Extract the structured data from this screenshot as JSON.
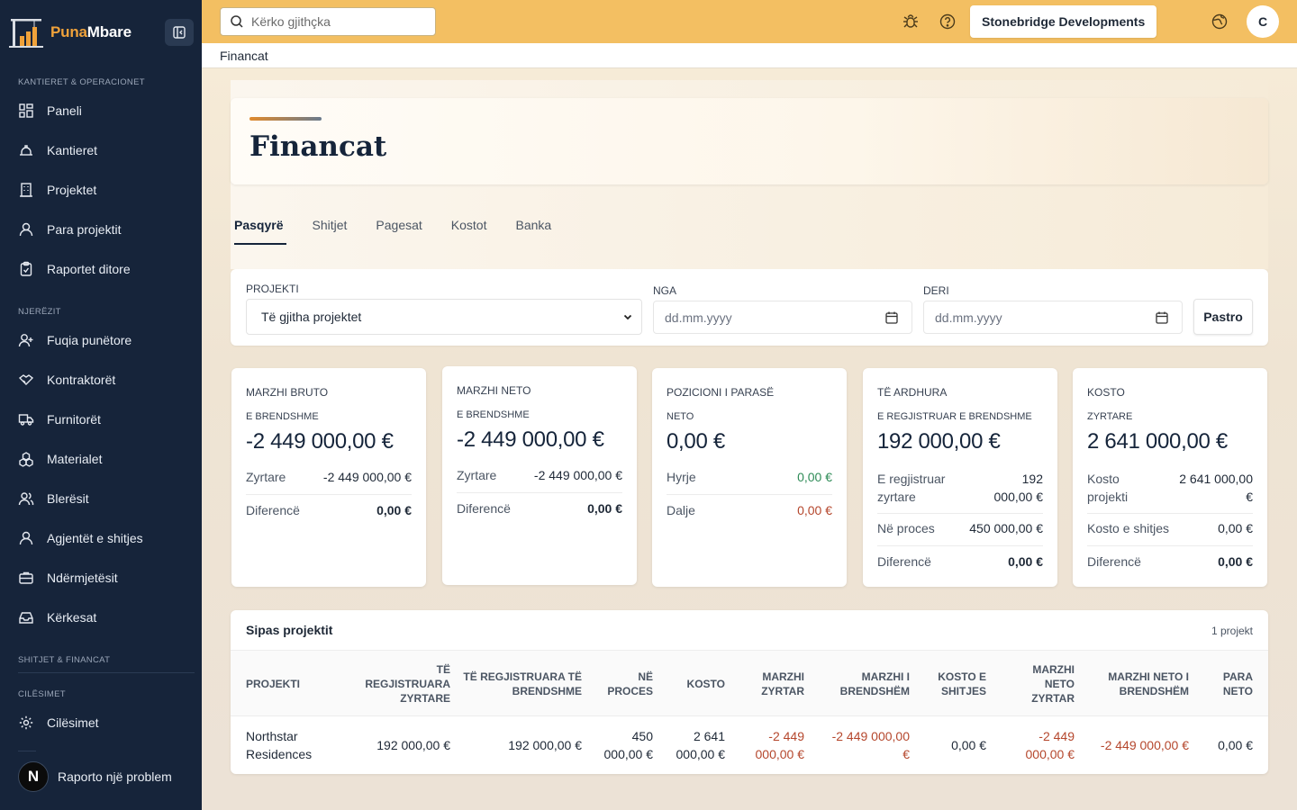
{
  "app": {
    "brand_part1": "Puna",
    "brand_part2": "Mbare"
  },
  "sidebar": {
    "sections": {
      "sites": "KANTIERET & OPERACIONET",
      "people": "NJERËZIT",
      "finance": "SHITJET & FINANCAT",
      "settings": "CILËSIMET"
    },
    "items": {
      "dashboard": "Paneli",
      "sites": "Kantieret",
      "projects": "Projektet",
      "project_money": "Para projektit",
      "daily_reports": "Raportet ditore",
      "workforce": "Fuqia punëtore",
      "contractors": "Kontraktorët",
      "suppliers": "Furnitorët",
      "materials": "Materialet",
      "buyers": "Blerësit",
      "sales_agents": "Agjentët e shitjes",
      "intermediaries": "Ndërmjetësit",
      "requests": "Kërkesat",
      "settings": "Cilësimet"
    },
    "report_problem": "Raporto një problem",
    "report_badge": "N"
  },
  "topbar": {
    "search_placeholder": "Kërko gjithçka",
    "company": "Stonebridge Developments",
    "avatar_initial": "C"
  },
  "breadcrumb": "Financat",
  "page": {
    "title": "Financat",
    "tabs": [
      "Pasqyrë",
      "Shitjet",
      "Pagesat",
      "Kostot",
      "Banka"
    ]
  },
  "filters": {
    "project_label": "PROJEKTI",
    "project_value": "Të gjitha projektet",
    "from_label": "NGA",
    "from_placeholder": "dd.mm.yyyy",
    "to_label": "DERI",
    "to_placeholder": "dd.mm.yyyy",
    "clear_label": "Pastro"
  },
  "cards": [
    {
      "title": "MARZHI BRUTO",
      "subtitle": "E BRENDSHME",
      "value": "-2 449 000,00 €",
      "rows": [
        {
          "k": "Zyrtare",
          "v": "-2 449 000,00 €"
        },
        {
          "k": "Diferencë",
          "v": "0,00 €"
        }
      ]
    },
    {
      "title": "MARZHI NETO",
      "subtitle": "E BRENDSHME",
      "value": "-2 449 000,00 €",
      "rows": [
        {
          "k": "Zyrtare",
          "v": "-2 449 000,00 €"
        },
        {
          "k": "Diferencë",
          "v": "0,00 €"
        }
      ]
    },
    {
      "title": "POZICIONI I PARASË",
      "subtitle": "NETO",
      "value": "0,00 €",
      "rows": [
        {
          "k": "Hyrje",
          "v": "0,00 €"
        },
        {
          "k": "Dalje",
          "v": "0,00 €"
        }
      ]
    },
    {
      "title": "TË ARDHURA",
      "subtitle": "E REGJISTRUAR E BRENDSHME",
      "value": "192 000,00 €",
      "rows": [
        {
          "k1": "E regjistruar",
          "k2": "zyrtare",
          "v1": "192",
          "v2": "000,00 €"
        },
        {
          "k": "Në proces",
          "v": "450 000,00 €"
        },
        {
          "k": "Diferencë",
          "v": "0,00 €"
        }
      ]
    },
    {
      "title": "KOSTO",
      "subtitle": "ZYRTARE",
      "value": "2 641 000,00 €",
      "rows": [
        {
          "k1": "Kosto",
          "k2": "projekti",
          "v1": "2 641 000,00",
          "v2": "€"
        },
        {
          "k": "Kosto e shitjes",
          "v": "0,00 €"
        },
        {
          "k": "Diferencë",
          "v": "0,00 €"
        }
      ]
    }
  ],
  "table": {
    "title": "Sipas projektit",
    "count": "1 projekt",
    "headers": [
      [
        "PROJEKTI"
      ],
      [
        "TË REGJISTRUARA",
        "ZYRTARE"
      ],
      [
        "TË REGJISTRUARA TË",
        "BRENDSHME"
      ],
      [
        "NË",
        "PROCES"
      ],
      [
        "KOSTO"
      ],
      [
        "MARZHI",
        "ZYRTAR"
      ],
      [
        "MARZHI I",
        "BRENDSHËM"
      ],
      [
        "KOSTO E",
        "SHITJES"
      ],
      [
        "MARZHI",
        "NETO",
        "ZYRTAR"
      ],
      [
        "MARZHI NETO I",
        "BRENDSHËM"
      ],
      [
        "PARA",
        "NETO"
      ]
    ],
    "rows": [
      [
        [
          "Northstar",
          "Residences"
        ],
        [
          "192 000,00 €"
        ],
        [
          "192 000,00 €"
        ],
        [
          "450",
          "000,00 €"
        ],
        [
          "2 641",
          "000,00 €"
        ],
        [
          "-2 449",
          "000,00 €"
        ],
        [
          "-2 449 000,00",
          "€"
        ],
        [
          "0,00 €"
        ],
        [
          "-2 449",
          "000,00 €"
        ],
        [
          "-2 449 000,00 €"
        ],
        [
          "0,00 €"
        ]
      ]
    ]
  }
}
